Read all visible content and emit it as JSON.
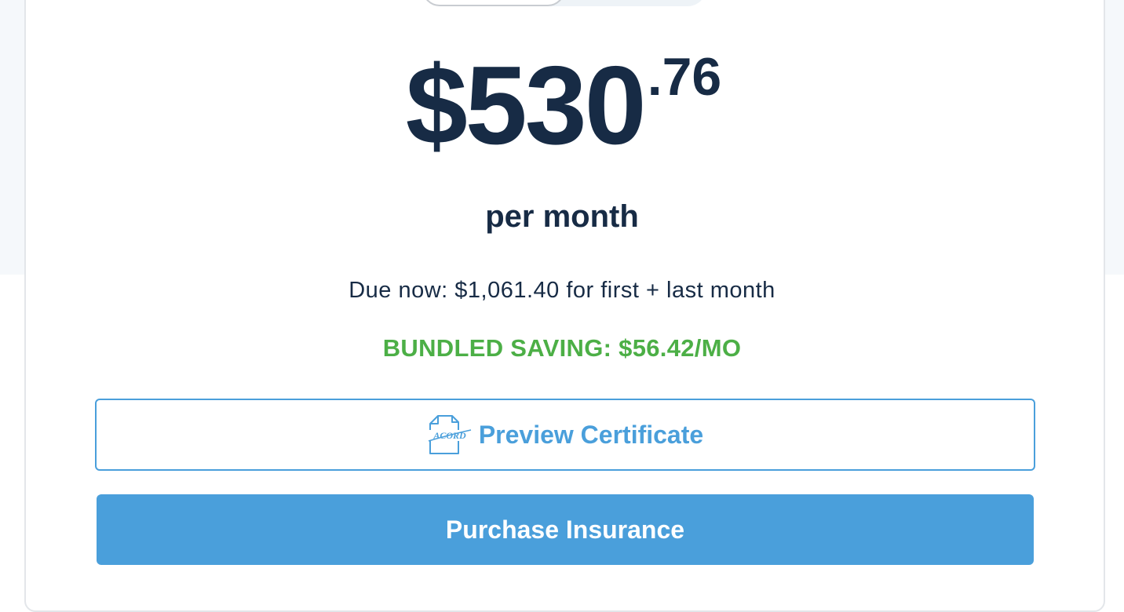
{
  "quote": {
    "price_main": "$530",
    "price_cents": ".76",
    "period": "per month",
    "due_now": "Due now: $1,061.40 for first + last month",
    "bundled_saving": "BUNDLED SAVING: $56.42/MO"
  },
  "actions": {
    "preview_label": "Preview Certificate",
    "preview_icon": "acord-document-icon",
    "purchase_label": "Purchase Insurance"
  },
  "icon_text": {
    "acord": "ACORD"
  },
  "colors": {
    "primary": "#4a9fdb",
    "text": "#172b45",
    "saving": "#4caf46",
    "background_band": "#f5f8fb",
    "card_border": "#e3e6ea"
  }
}
